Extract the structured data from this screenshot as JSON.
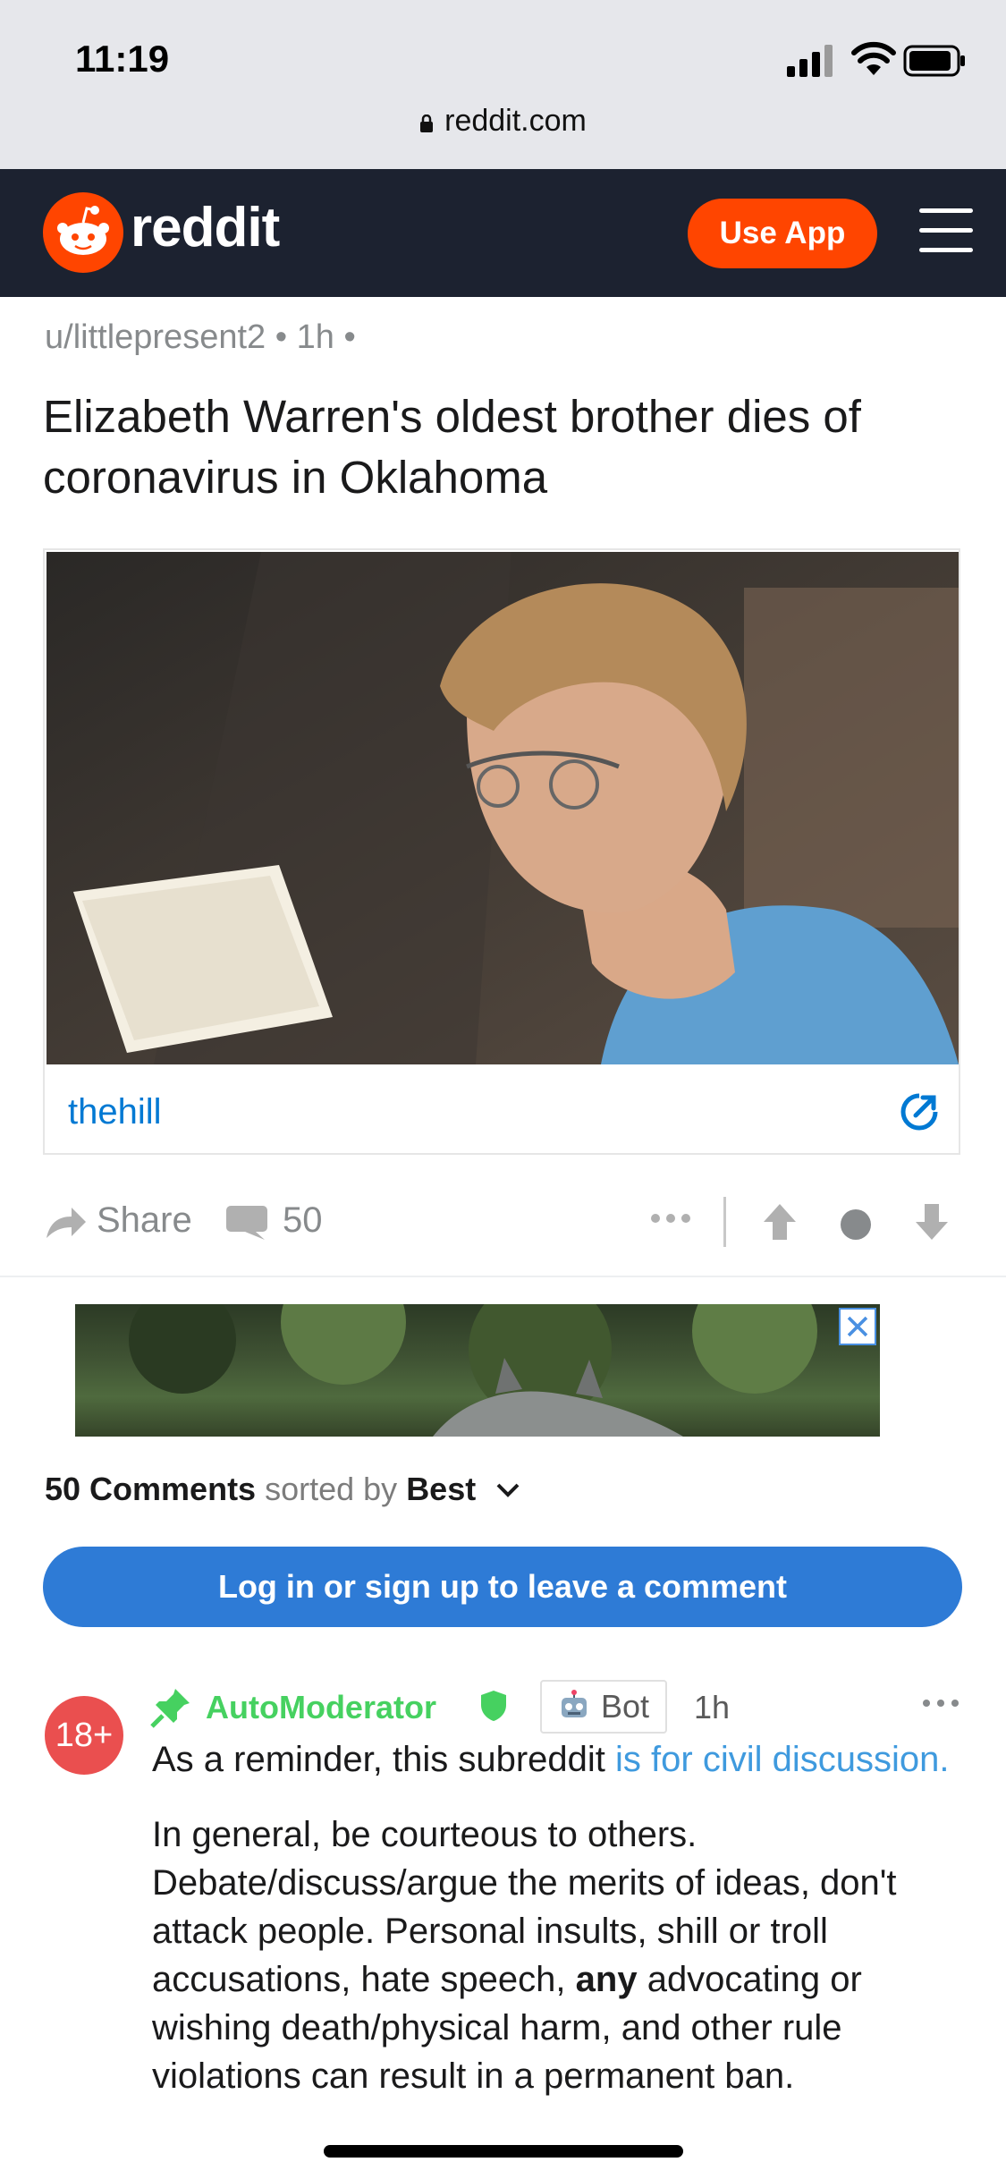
{
  "status_bar": {
    "time": "11:19",
    "url": "reddit.com"
  },
  "header": {
    "brand": "reddit",
    "use_app_label": "Use App",
    "accent": "#ff4500",
    "bg": "#1c2230"
  },
  "post": {
    "author": "u/littlepresent2",
    "age": "1h",
    "title": "Elizabeth Warren's oldest brother dies of coronavirus in Oklahoma",
    "link_domain": "thehill",
    "share_label": "Share",
    "comment_count": "50"
  },
  "comments_header": {
    "count_label": "50 Comments",
    "sorted_by": "sorted by",
    "sort_value": "Best"
  },
  "login_button": "Log in or sign up to leave a comment",
  "comment": {
    "badge": "18+",
    "author": "AutoModerator",
    "tag": "Bot",
    "age": "1h",
    "p1_text": "As a reminder, this subreddit ",
    "p1_link": "is for civil discussion.",
    "p2_a": "In general, be courteous to others. Debate/discuss/argue the merits of ideas, don't attack people. Personal insults, shill or troll accusations, hate speech, ",
    "p2_bold": "any",
    "p2_b": " advocating or wishing death/physical harm, and other rule violations can result in a permanent ban."
  },
  "icons": [
    "lock-icon",
    "reddit-logo-icon",
    "menu-icon",
    "external-link-icon",
    "share-icon",
    "comment-icon",
    "more-icon",
    "upvote-icon",
    "downvote-icon",
    "close-icon",
    "chevron-down-icon",
    "pin-icon",
    "shield-icon",
    "robot-icon"
  ]
}
